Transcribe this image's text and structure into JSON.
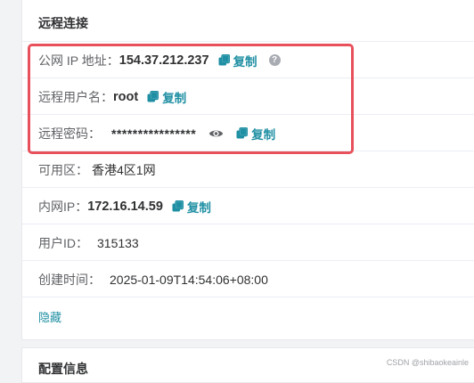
{
  "section": {
    "title": "远程连接",
    "hide_label": "隐藏"
  },
  "rows": {
    "public_ip": {
      "label": "公网 IP 地址：",
      "value": "154.37.212.237"
    },
    "username": {
      "label": "远程用户名：",
      "value": "root"
    },
    "password": {
      "label": "远程密码：",
      "value": "****************"
    },
    "zone": {
      "label": "可用区：",
      "value": "香港4区1网"
    },
    "private_ip": {
      "label": "内网IP：",
      "value": "172.16.14.59"
    },
    "user_id": {
      "label": "用户ID：",
      "value": "315133"
    },
    "created": {
      "label": "创建时间：",
      "value": "2025-01-09T14:54:06+08:00"
    }
  },
  "copy_label": "复制",
  "help_glyph": "?",
  "config_section": {
    "title": "配置信息"
  },
  "watermark": "CSDN @shibaokeainle",
  "icons": {
    "copy": "copy-icon",
    "help": "question-circle-icon",
    "eye": "eye-icon"
  },
  "colors": {
    "accent": "#1f8fa3",
    "highlight": "#e8505b"
  }
}
